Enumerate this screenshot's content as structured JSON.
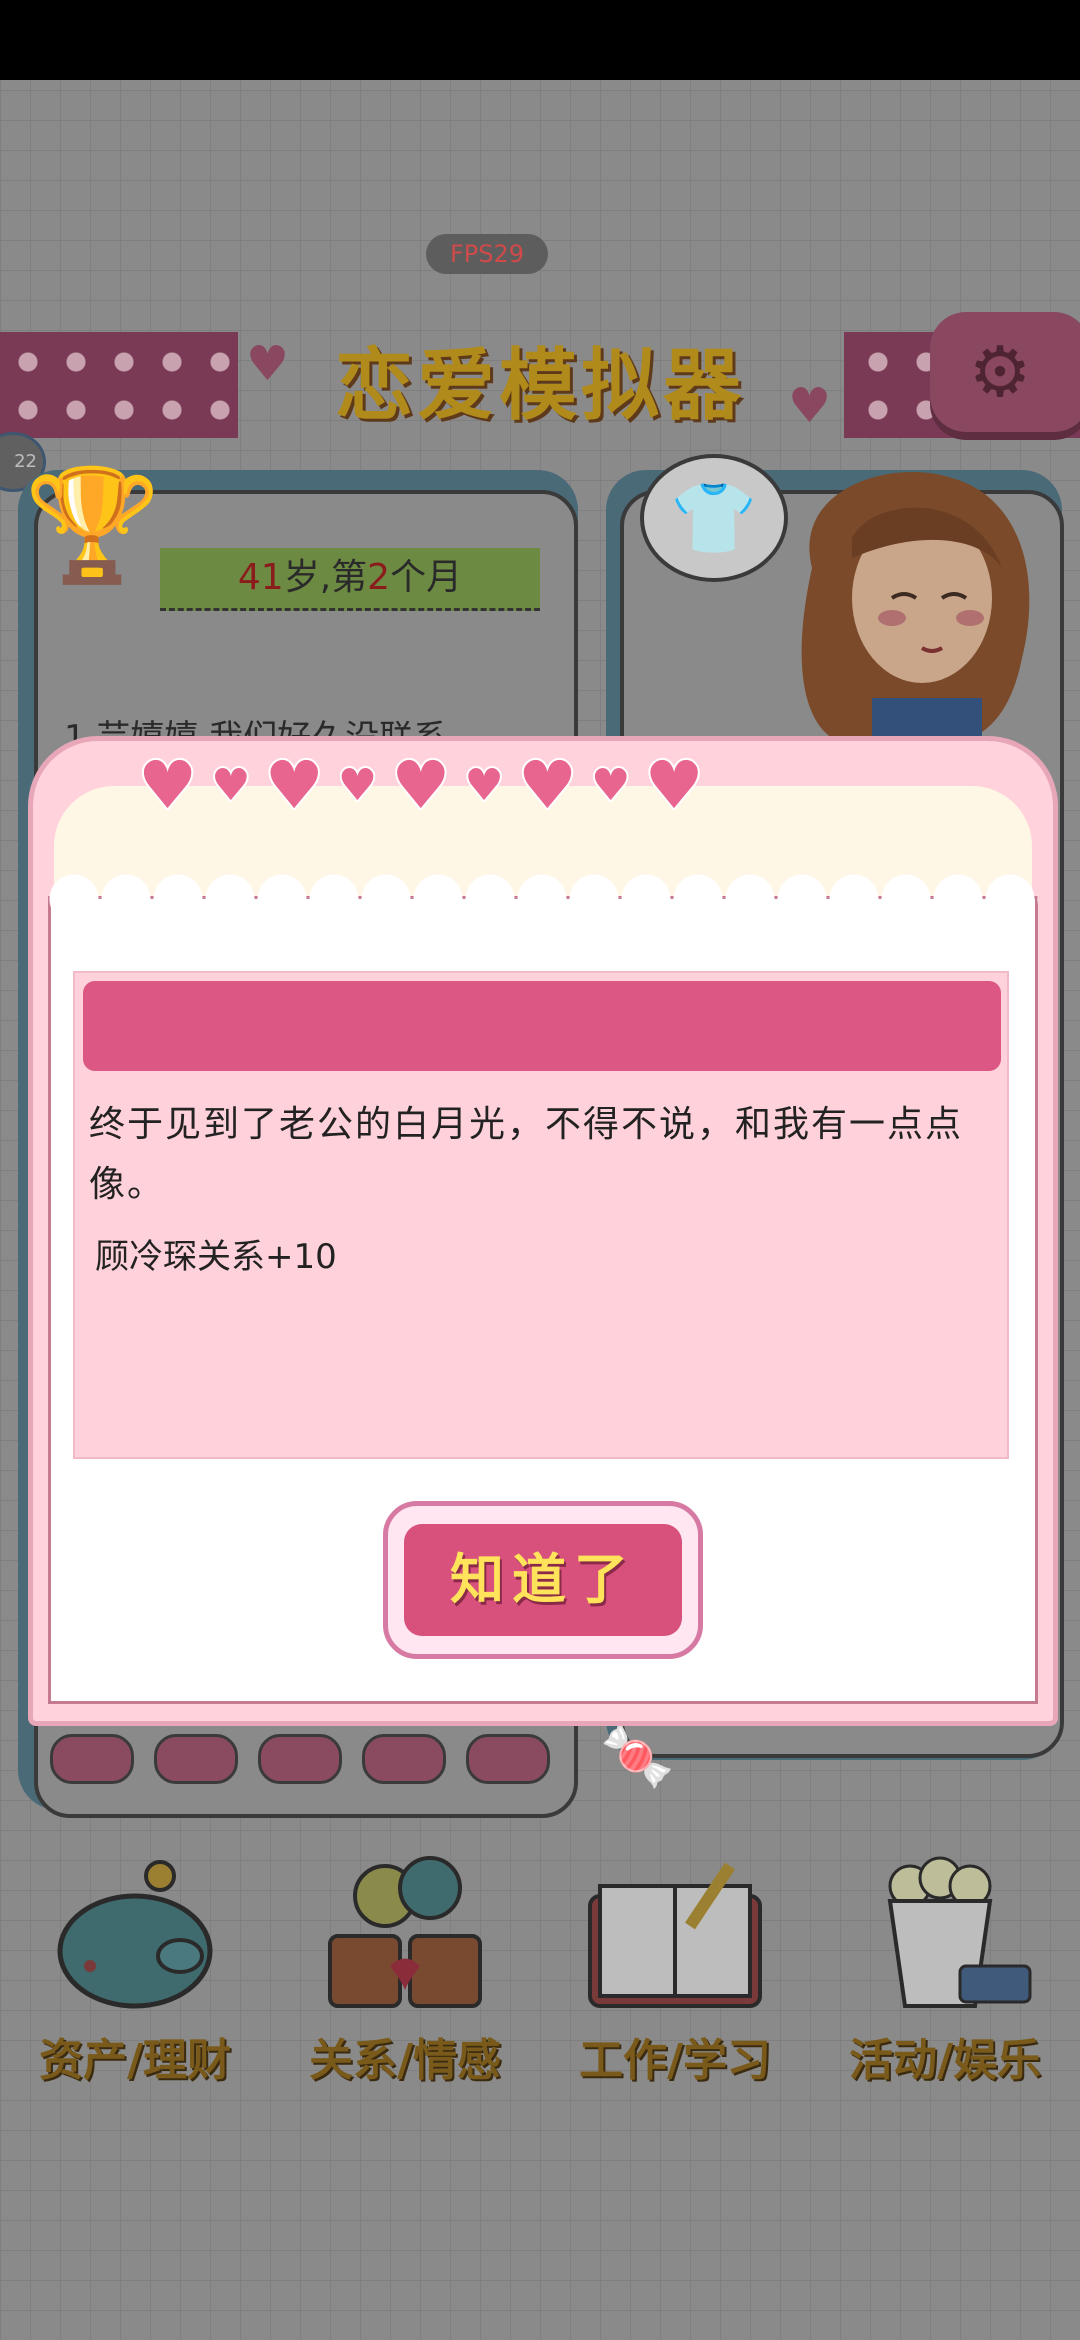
{
  "fps_label": "FPS29",
  "title": "恋爱模拟器",
  "avatar_tag": "22",
  "age_status": {
    "age": "41",
    "age_unit": "岁,第",
    "month": "2",
    "month_unit": "个月"
  },
  "background_log_text": "1.芸嬉嬉 我们好久没联系",
  "dialog": {
    "header": "",
    "message": "终于见到了老公的白月光，不得不说，和我有一点点像。",
    "effect": "顾冷琛关系+10",
    "confirm_label": "知道了"
  },
  "nav": [
    {
      "label": "资产/理财",
      "icon": "piggy-bank-icon"
    },
    {
      "label": "关系/情感",
      "icon": "coffee-couple-icon"
    },
    {
      "label": "工作/学习",
      "icon": "book-pen-icon"
    },
    {
      "label": "活动/娱乐",
      "icon": "popcorn-tickets-icon"
    }
  ],
  "colors": {
    "accent": "#dc5783",
    "dialog_bg": "#ffd2dc",
    "button_text": "#ffe35a"
  }
}
